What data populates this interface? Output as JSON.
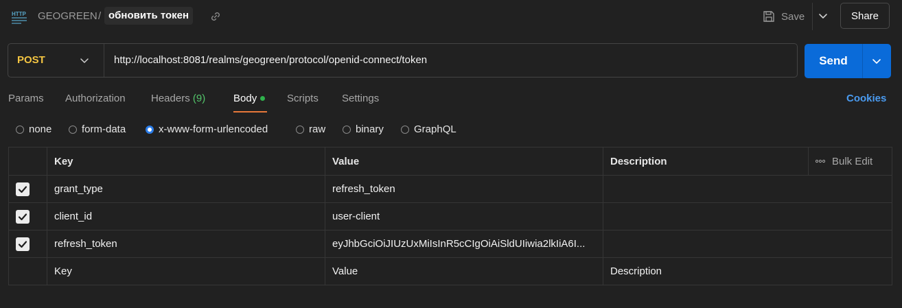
{
  "header": {
    "icon": "http-icon",
    "workspace": "GEOGREEN",
    "separator": "/",
    "request_name": "обновить токен",
    "save_label": "Save",
    "share_label": "Share"
  },
  "request": {
    "method": "POST",
    "url": "http://localhost:8081/realms/geogreen/protocol/openid-connect/token",
    "send_label": "Send"
  },
  "tabs": {
    "params": "Params",
    "authorization": "Authorization",
    "headers": "Headers",
    "headers_count": "(9)",
    "body": "Body",
    "scripts": "Scripts",
    "settings": "Settings",
    "cookies": "Cookies",
    "active": "Body"
  },
  "body_types": {
    "none": "none",
    "form_data": "form-data",
    "urlencoded": "x-www-form-urlencoded",
    "raw": "raw",
    "binary": "binary",
    "graphql": "GraphQL",
    "selected": "x-www-form-urlencoded"
  },
  "table": {
    "columns": {
      "key": "Key",
      "value": "Value",
      "description": "Description"
    },
    "bulk_edit": "Bulk Edit",
    "rows": [
      {
        "enabled": true,
        "key": "grant_type",
        "value": "refresh_token",
        "description": ""
      },
      {
        "enabled": true,
        "key": "client_id",
        "value": "user-client",
        "description": ""
      },
      {
        "enabled": true,
        "key": "refresh_token",
        "value": "eyJhbGciOiJIUzUxMiIsInR5cCIgOiAiSldUIiwia2lkIiA6I...",
        "description": ""
      }
    ],
    "placeholders": {
      "key": "Key",
      "value": "Value",
      "description": "Description"
    }
  },
  "colors": {
    "background": "#212121",
    "accent_send": "#0a6bd9",
    "method_post": "#f4c542",
    "cookies_link": "#4a9bf0",
    "tab_underline": "#e8783a"
  }
}
